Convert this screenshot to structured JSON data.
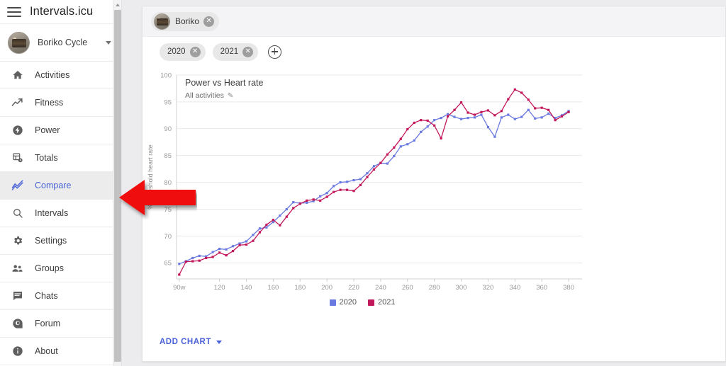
{
  "app": {
    "title": "Intervals.icu",
    "menu_icon": "hamburger-icon"
  },
  "sidebar": {
    "athlete": {
      "name": "Boriko Cycle",
      "avatar": "athlete-avatar",
      "caret": "chevron-down-icon"
    },
    "items": [
      {
        "label": "Activities",
        "icon": "home-icon",
        "active": false
      },
      {
        "label": "Fitness",
        "icon": "trending-up-icon",
        "active": false
      },
      {
        "label": "Power",
        "icon": "bolt-icon",
        "active": false
      },
      {
        "label": "Totals",
        "icon": "table-clock-icon",
        "active": false
      },
      {
        "label": "Compare",
        "icon": "compare-lines-icon",
        "active": true
      },
      {
        "label": "Intervals",
        "icon": "search-icon",
        "active": false
      },
      {
        "label": "Settings",
        "icon": "gear-icon",
        "active": false
      },
      {
        "label": "Groups",
        "icon": "people-icon",
        "active": false
      },
      {
        "label": "Chats",
        "icon": "chat-icon",
        "active": false
      },
      {
        "label": "Forum",
        "icon": "forum-icon",
        "active": false
      },
      {
        "label": "About",
        "icon": "info-icon",
        "active": false
      }
    ]
  },
  "main": {
    "athlete_chip": {
      "label": "Boriko",
      "remove_icon": "close-circle-icon"
    },
    "year_chips": [
      {
        "label": "2020",
        "remove_icon": "close-circle-icon"
      },
      {
        "label": "2021",
        "remove_icon": "close-circle-icon"
      }
    ],
    "add_year_icon": "plus-circle-icon",
    "add_chart": {
      "label": "ADD CHART",
      "caret_icon": "chevron-down-icon"
    }
  },
  "annotation": {
    "arrow": {
      "color": "#f00c0c",
      "points_to": "sidebar-item-compare",
      "direction": "left"
    }
  },
  "colors": {
    "accent": "#4a62d8",
    "series_2020": "#6b7ae0",
    "series_2021": "#c2185b",
    "arrow_red": "#f00c0c"
  },
  "chart_data": {
    "type": "line",
    "title": "Power vs Heart rate",
    "subtitle": "All activities",
    "subtitle_edit_icon": "pencil-icon",
    "xlabel": "",
    "ylabel": "% Threshold heart rate",
    "xlim": [
      88,
      390
    ],
    "ylim": [
      62,
      100
    ],
    "grid": true,
    "legend_position": "bottom",
    "xticks": [
      "90w",
      "120",
      "140",
      "160",
      "180",
      "200",
      "220",
      "240",
      "260",
      "280",
      "300",
      "320",
      "340",
      "360",
      "380"
    ],
    "xtick_values": [
      90,
      120,
      140,
      160,
      180,
      200,
      220,
      240,
      260,
      280,
      300,
      320,
      340,
      360,
      380
    ],
    "yticks": [
      65,
      70,
      75,
      80,
      85,
      90,
      95,
      100
    ],
    "series": [
      {
        "name": "2020",
        "color": "#6b7ae0",
        "x": [
          90,
          95,
          100,
          105,
          110,
          115,
          120,
          125,
          130,
          135,
          140,
          145,
          150,
          155,
          160,
          165,
          170,
          175,
          180,
          185,
          190,
          195,
          200,
          205,
          210,
          215,
          220,
          225,
          230,
          235,
          240,
          245,
          250,
          255,
          260,
          265,
          270,
          275,
          280,
          285,
          290,
          295,
          300,
          305,
          310,
          315,
          320,
          325,
          330,
          335,
          340,
          345,
          350,
          355,
          360,
          365,
          370,
          375,
          380
        ],
        "y": [
          64.8,
          65.3,
          65.9,
          66.3,
          66.2,
          67.0,
          67.6,
          67.5,
          68.1,
          68.6,
          69.0,
          70.2,
          71.4,
          71.6,
          72.6,
          73.8,
          75.0,
          76.3,
          76.1,
          76.2,
          76.5,
          77.4,
          78.0,
          79.3,
          80.0,
          80.1,
          80.4,
          80.6,
          81.7,
          83.0,
          83.6,
          83.5,
          84.9,
          86.7,
          87.1,
          87.8,
          89.4,
          90.4,
          91.6,
          92.0,
          92.7,
          92.2,
          91.8,
          92.0,
          92.1,
          92.6,
          90.3,
          88.5,
          92.1,
          92.6,
          91.8,
          92.2,
          93.5,
          91.9,
          92.1,
          92.8,
          92.0,
          92.5,
          93.3
        ]
      },
      {
        "name": "2021",
        "color": "#c2185b",
        "x": [
          90,
          95,
          100,
          105,
          110,
          115,
          120,
          125,
          130,
          135,
          140,
          145,
          150,
          155,
          160,
          165,
          170,
          175,
          180,
          185,
          190,
          195,
          200,
          205,
          210,
          215,
          220,
          225,
          230,
          235,
          240,
          245,
          250,
          255,
          260,
          265,
          270,
          275,
          280,
          285,
          290,
          295,
          300,
          305,
          310,
          315,
          320,
          325,
          330,
          335,
          340,
          345,
          350,
          355,
          360,
          365,
          370,
          375,
          380
        ],
        "y": [
          62.8,
          65.2,
          65.3,
          65.4,
          65.9,
          66.1,
          66.9,
          66.4,
          67.2,
          68.3,
          68.4,
          69.1,
          70.7,
          72.1,
          73.0,
          72.0,
          73.6,
          75.2,
          76.0,
          76.6,
          76.8,
          76.6,
          77.3,
          78.2,
          78.6,
          78.6,
          78.4,
          79.5,
          81.0,
          82.4,
          83.6,
          85.2,
          86.5,
          88.1,
          89.9,
          91.1,
          91.6,
          91.5,
          90.6,
          88.2,
          92.3,
          93.5,
          94.9,
          93.0,
          92.6,
          93.1,
          93.4,
          92.5,
          93.3,
          95.5,
          97.3,
          96.7,
          95.4,
          93.8,
          93.9,
          93.5,
          91.6,
          92.3,
          93.1
        ]
      }
    ]
  }
}
